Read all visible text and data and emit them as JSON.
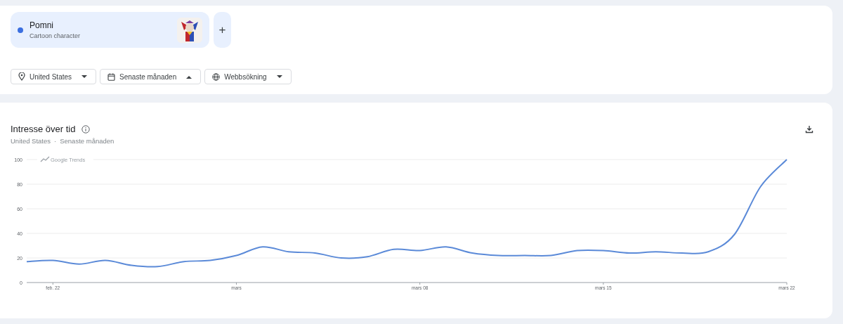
{
  "search_term": {
    "name": "Pomni",
    "type": "Cartoon character",
    "color": "#3b6fe0",
    "add_button": "+"
  },
  "filters": [
    {
      "kind": "location",
      "label": "United States",
      "expanded": false
    },
    {
      "kind": "date",
      "label": "Senaste månaden",
      "expanded": true
    },
    {
      "kind": "web",
      "label": "Webbsökning",
      "expanded": false
    }
  ],
  "interest_panel": {
    "title": "Intresse över tid",
    "subtitle_region": "United States",
    "separator": "·",
    "subtitle_period": "Senaste månaden",
    "chart_brand": "Google Trends",
    "chart_data": {
      "type": "line",
      "categories": [
        null,
        "feb. 22",
        null,
        null,
        null,
        null,
        null,
        null,
        "mars",
        null,
        null,
        null,
        null,
        null,
        null,
        "mars 08",
        null,
        null,
        null,
        null,
        null,
        null,
        "mars 15",
        null,
        null,
        null,
        null,
        null,
        null,
        "mars 22"
      ],
      "series": [
        {
          "color": "#5b8ad8",
          "values": [
            17,
            18,
            15,
            18,
            14,
            13,
            17,
            18,
            22,
            29,
            25,
            24,
            20,
            21,
            27,
            26,
            29,
            24,
            22,
            22,
            22,
            26,
            26,
            24,
            25,
            24,
            25,
            39,
            78,
            100
          ]
        }
      ],
      "ylim": [
        0,
        100
      ],
      "yticks": [
        0,
        20,
        40,
        60,
        80,
        100
      ],
      "grid": true
    }
  }
}
